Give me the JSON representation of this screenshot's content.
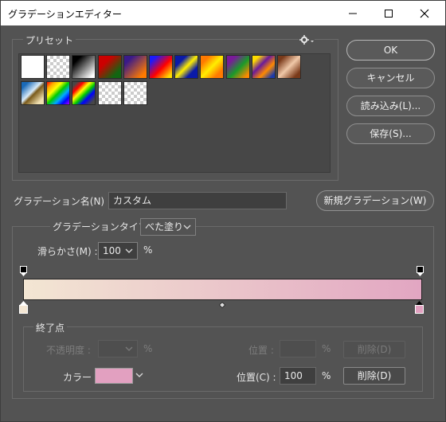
{
  "window": {
    "title": "グラデーションエディター"
  },
  "presets": {
    "label": "プリセット",
    "swatches": [
      {
        "name": "white",
        "bg": "linear-gradient(to right,#ffffff,#ffffff)"
      },
      {
        "name": "transparent-white",
        "bg": "checker"
      },
      {
        "name": "black-white",
        "bg": "linear-gradient(135deg,#000 20%,#fff 90%)"
      },
      {
        "name": "red-green",
        "bg": "linear-gradient(135deg,#cc0000 30%,#116611 80%)"
      },
      {
        "name": "violet-orange",
        "bg": "linear-gradient(135deg,#3a1a8a 20%,#ff7a00 85%)"
      },
      {
        "name": "blue-red-yellow",
        "bg": "linear-gradient(135deg,#1a1aff 15%,#ff0000 55%,#ffdd00 90%)"
      },
      {
        "name": "blue-yellow-blue",
        "bg": "linear-gradient(135deg,#0a1aa8 25%,#ffee00 50%,#0a1aa8 75%)"
      },
      {
        "name": "orange-yellow-orange",
        "bg": "linear-gradient(135deg,#ff7a00 20%,#ffee00 50%,#ff7a00 80%)"
      },
      {
        "name": "violet-green-orange",
        "bg": "linear-gradient(135deg,#7a1a9a 20%,#1a9a2a 55%,#ff8a00 90%)"
      },
      {
        "name": "yellow-violet-orange-blue",
        "bg": "linear-gradient(135deg,#ffdd00 15%,#6a1a9a 40%,#ff8a00 65%,#1a3aaa 90%)"
      },
      {
        "name": "copper",
        "bg": "linear-gradient(135deg,#7a3a1a 15%,#f0c8a8 50%,#7a3a1a 85%)"
      },
      {
        "name": "chrome",
        "bg": "linear-gradient(135deg,#1a6ab8 15%,#d8eaf8 45%,#7a5a1a 55%,#f0e0b0 85%)"
      },
      {
        "name": "spectrum",
        "bg": "linear-gradient(135deg,#ff0000,#ffaa00,#ffff00,#00cc00,#00aaff,#0000ff,#aa00ff)"
      },
      {
        "name": "transparent-rainbow",
        "bg": "linear-gradient(135deg,#ff000000 10%,#ff0000 25%,#ffff00 40%,#00cc00 55%,#0000ff 70%,#ff00ff00 90%)"
      },
      {
        "name": "transparent-stripes",
        "bg": "checker"
      },
      {
        "name": "neutral-density",
        "bg": "checker"
      }
    ]
  },
  "buttons": {
    "ok": "OK",
    "cancel": "キャンセル",
    "load": "読み込み(L)...",
    "save": "保存(S)...",
    "new_gradient": "新規グラデーション(W)"
  },
  "gradient_name": {
    "label": "グラデーション名(N) :",
    "value": "カスタム"
  },
  "gradient_type": {
    "label": "グラデーションタイプ :",
    "value": "べた塗り"
  },
  "smoothness": {
    "label": "滑らかさ(M) :",
    "value": "100",
    "unit": "%"
  },
  "gradient_colors": {
    "start": "#f3e6d3",
    "end": "#e2a6c2"
  },
  "stops": {
    "label": "終了点",
    "opacity_label": "不透明度 :",
    "opacity_unit": "%",
    "opacity_location_label": "位置 :",
    "opacity_location_unit": "%",
    "opacity_delete": "削除(D)",
    "color_label": "カラー :",
    "color_value": "#e2a0c0",
    "color_location_label": "位置(C) :",
    "color_location_value": "100",
    "color_location_unit": "%",
    "color_delete": "削除(D)"
  }
}
